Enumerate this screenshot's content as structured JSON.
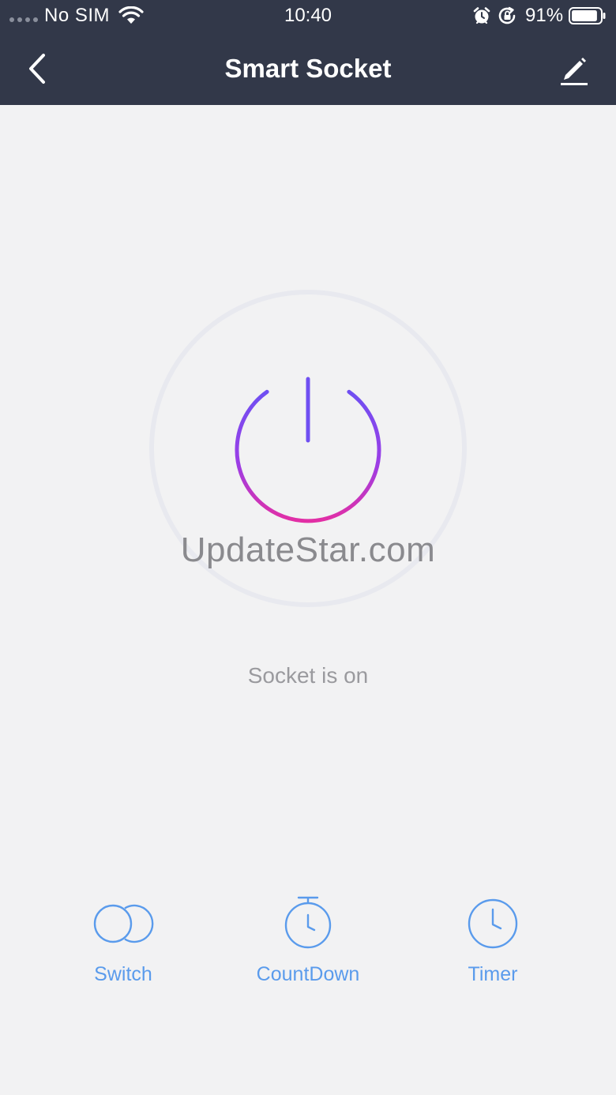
{
  "status_bar": {
    "carrier": "No SIM",
    "time": "10:40",
    "battery_percent": "91%",
    "battery_level": 0.91,
    "icons": [
      "signal-dots",
      "wifi-icon",
      "alarm-icon",
      "rotation-lock-icon",
      "battery-icon"
    ]
  },
  "nav": {
    "title": "Smart Socket",
    "back_icon": "chevron-left-icon",
    "edit_icon": "pencil-icon"
  },
  "power": {
    "icon": "power-icon",
    "state": "on",
    "watermark": "UpdateStar.com",
    "status_text": "Socket is on",
    "gradient_colors": [
      "#6f4ff2",
      "#9b3ee6",
      "#e22fa5"
    ]
  },
  "functions": [
    {
      "label": "Switch",
      "icon": "switch-icon"
    },
    {
      "label": "CountDown",
      "icon": "stopwatch-icon"
    },
    {
      "label": "Timer",
      "icon": "clock-icon"
    }
  ],
  "colors": {
    "header_bg": "#323849",
    "page_bg": "#f2f2f3",
    "accent": "#5a9bec",
    "ring": "#e8e9ef"
  }
}
